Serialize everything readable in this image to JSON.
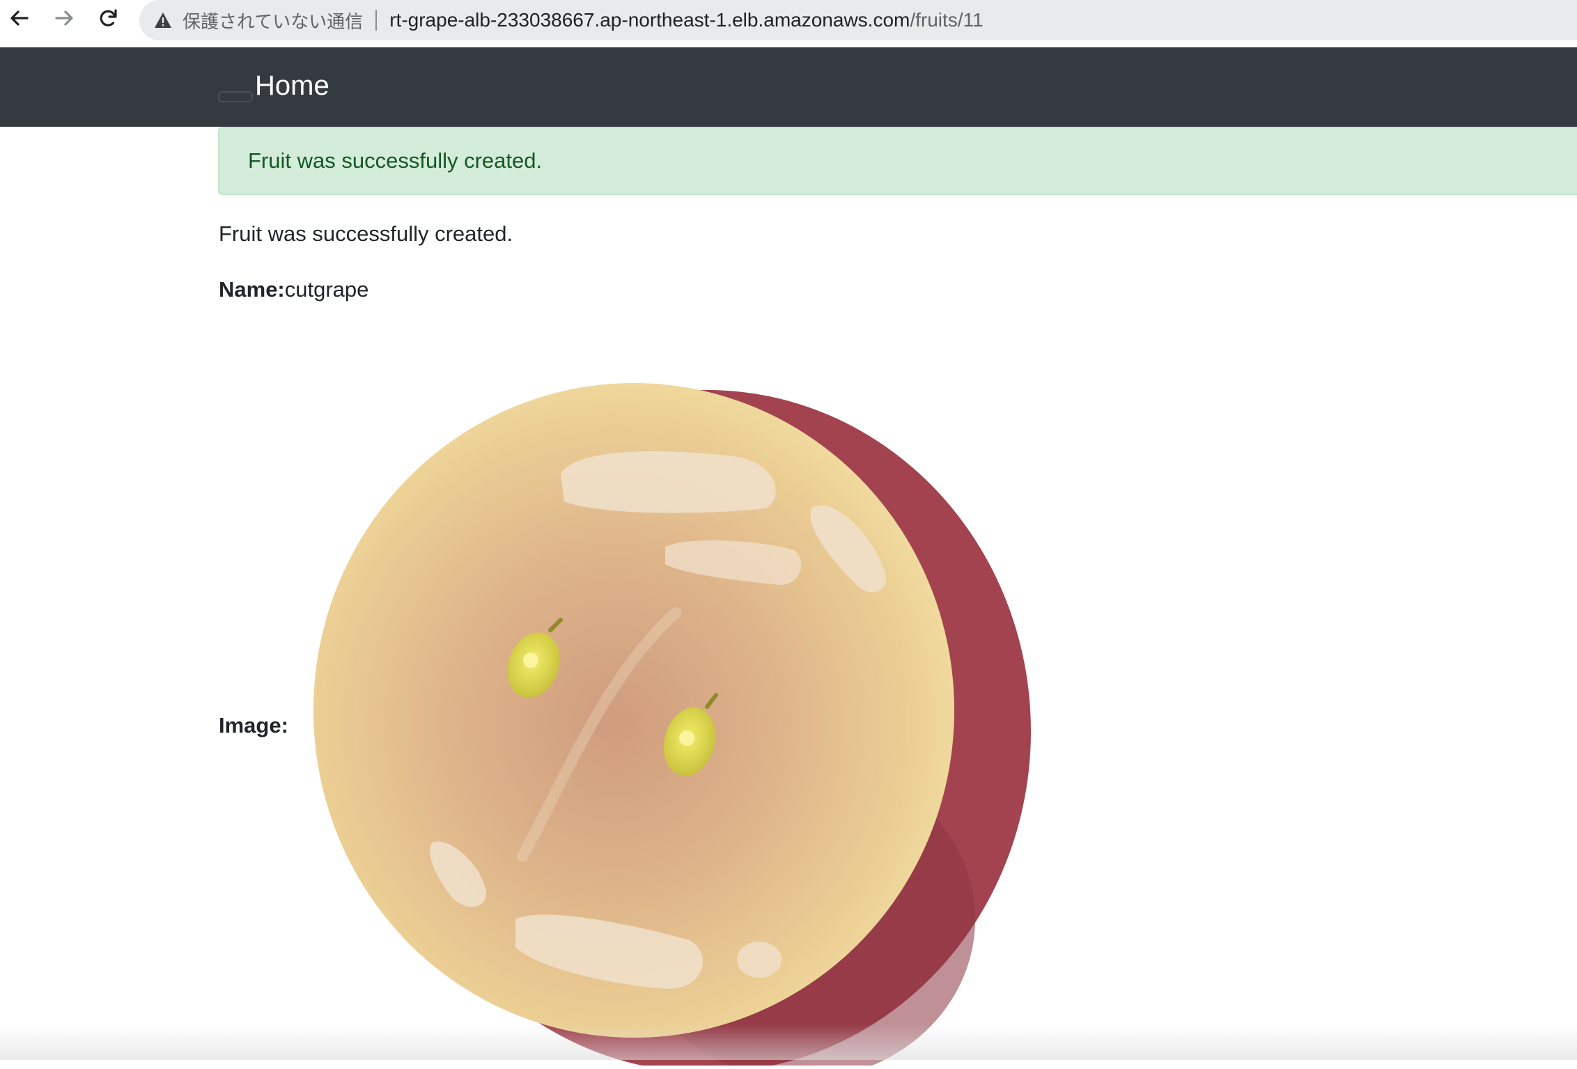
{
  "browser": {
    "back_icon": "arrow-left-icon",
    "forward_icon": "arrow-right-icon",
    "reload_icon": "reload-icon",
    "security_icon": "warning-triangle-icon",
    "security_label": "保護されていない通信",
    "url_host": "rt-grape-alb-233038667.ap-northeast-1.elb.amazonaws.com",
    "url_path": "/fruits/11"
  },
  "navbar": {
    "brand": "Home",
    "background_color": "#343a40"
  },
  "alert": {
    "message": "Fruit was successfully created.",
    "background_color": "#d4edda",
    "text_color": "#155724"
  },
  "page": {
    "notice": "Fruit was successfully created.",
    "name_label": "Name:",
    "name_value": "cutgrape",
    "image_label": "Image:",
    "image_icon": "cut-grape-illustration"
  }
}
